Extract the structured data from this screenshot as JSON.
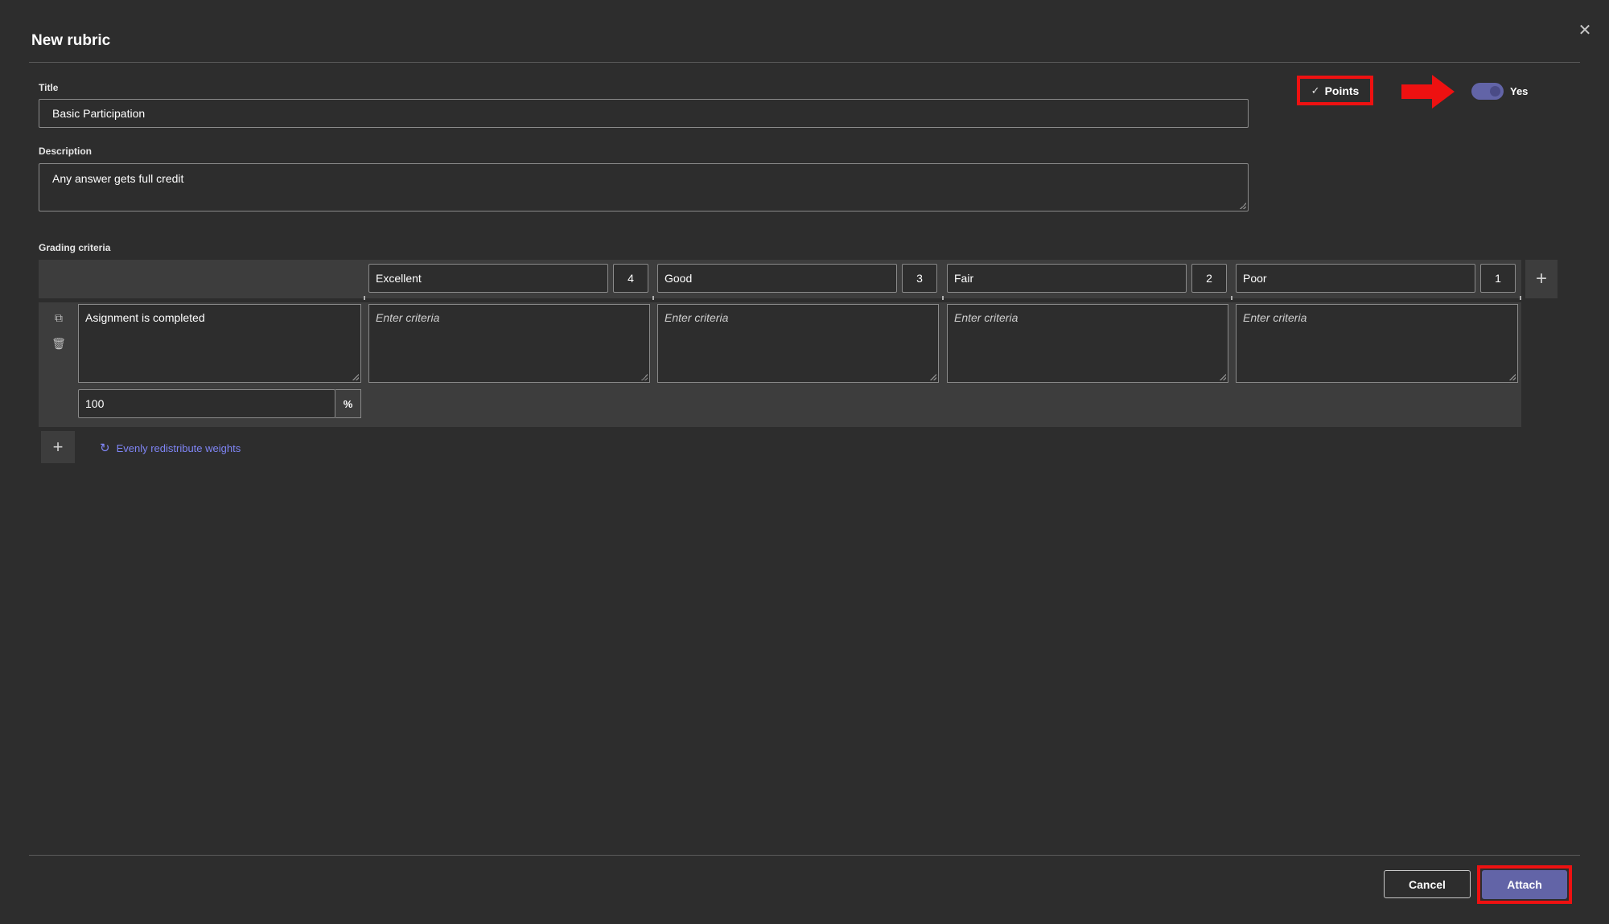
{
  "dialog": {
    "title": "New rubric",
    "close_icon": "close-icon"
  },
  "form": {
    "title_label": "Title",
    "title_value": "Basic Participation",
    "description_label": "Description",
    "description_value": "Any answer gets full credit"
  },
  "points_option": {
    "label": "Points",
    "icon": "check-icon"
  },
  "points_toggle": {
    "label": "Yes",
    "state": "on"
  },
  "grading": {
    "label": "Grading criteria",
    "levels": [
      {
        "name": "Excellent",
        "points": "4"
      },
      {
        "name": "Good",
        "points": "3"
      },
      {
        "name": "Fair",
        "points": "2"
      },
      {
        "name": "Poor",
        "points": "1"
      }
    ],
    "rows": [
      {
        "criterion": "Asignment is completed",
        "descriptors": [
          "Enter criteria",
          "Enter criteria",
          "Enter criteria",
          "Enter criteria"
        ],
        "weight": "100",
        "weight_unit": "%"
      }
    ],
    "redistribute_label": "Evenly redistribute weights"
  },
  "footer": {
    "cancel_label": "Cancel",
    "attach_label": "Attach"
  },
  "colors": {
    "background": "#2d2d2d",
    "accent": "#6264a7",
    "highlight": "#ee1111",
    "link": "#7f85f5"
  }
}
